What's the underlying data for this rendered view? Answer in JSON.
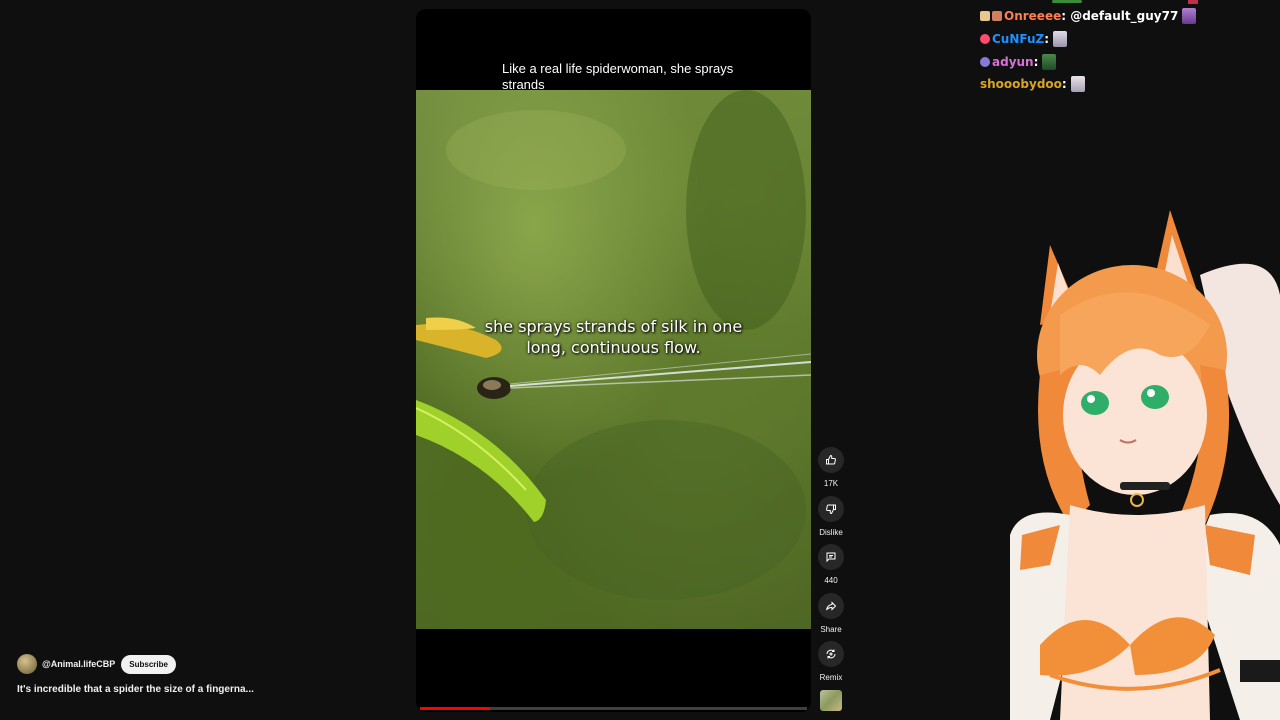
{
  "video": {
    "top_caption": "Like a real life spiderwoman, she sprays strands",
    "subtitle_line1": "she sprays strands of silk in one",
    "subtitle_line2": "long, continuous flow.",
    "progress_fraction": 0.18
  },
  "actions": {
    "like_count": "17K",
    "dislike_label": "Dislike",
    "comment_count": "440",
    "share_label": "Share",
    "remix_label": "Remix"
  },
  "channel": {
    "handle": "@Animal.lifeCBP",
    "subscribe_label": "Subscribe",
    "video_title": "It's incredible that a spider the size of a fingerna..."
  },
  "chat": {
    "messages": [
      {
        "user": "Onreeee",
        "text": "@default_guy77",
        "user_color": "#ff7f50"
      },
      {
        "user": "CuNFuZ",
        "text": "",
        "user_color": "#1e90ff"
      },
      {
        "user": "adyun",
        "text": "",
        "user_color": "#da70d6"
      },
      {
        "user": "shooobydoo",
        "text": "",
        "user_color": "#daa520"
      }
    ]
  },
  "colors": {
    "background": "#0f0f0f",
    "progress": "#ff0000",
    "action_button": "#272727"
  }
}
